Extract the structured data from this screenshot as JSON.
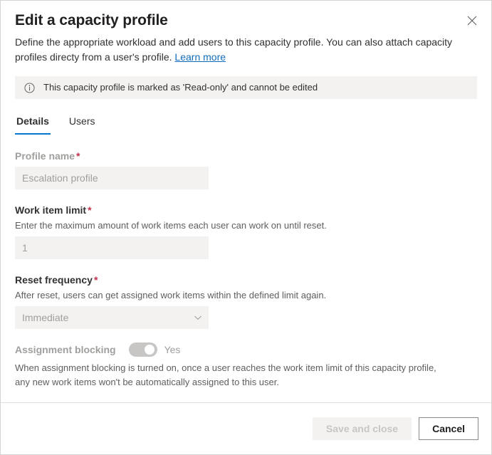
{
  "dialog": {
    "title": "Edit a capacity profile",
    "subtitle_before_link": "Define the appropriate workload and add users to this capacity profile. You can also attach capacity profiles directy from a user's profile. ",
    "learn_more_label": "Learn more",
    "close_icon": "close-icon"
  },
  "banner": {
    "icon": "info-icon",
    "text": "This capacity profile is marked as 'Read-only' and cannot be edited",
    "background": "#f3f2f1"
  },
  "tabs": [
    {
      "label": "Details",
      "active": true
    },
    {
      "label": "Users",
      "active": false
    }
  ],
  "tab_accent_color": "#0078d4",
  "form": {
    "profile_name": {
      "label": "Profile name",
      "required_marker": "*",
      "value": "Escalation profile"
    },
    "work_item_limit": {
      "label": "Work item limit",
      "required_marker": "*",
      "helper": "Enter the maximum amount of work items each user can work on until reset.",
      "value": "1"
    },
    "reset_frequency": {
      "label": "Reset frequency",
      "required_marker": "*",
      "helper": "After reset, users can get assigned work items within the defined limit again.",
      "value": "Immediate",
      "chevron_icon": "chevron-down-icon"
    },
    "assignment_blocking": {
      "label": "Assignment blocking",
      "state_label": "Yes",
      "description": "When assignment blocking is turned on, once a user reaches the work item limit of this capacity profile, any new work items won't be automatically assigned to this user."
    },
    "required_color": "#c4314b"
  },
  "footer": {
    "save_label": "Save and close",
    "cancel_label": "Cancel"
  }
}
